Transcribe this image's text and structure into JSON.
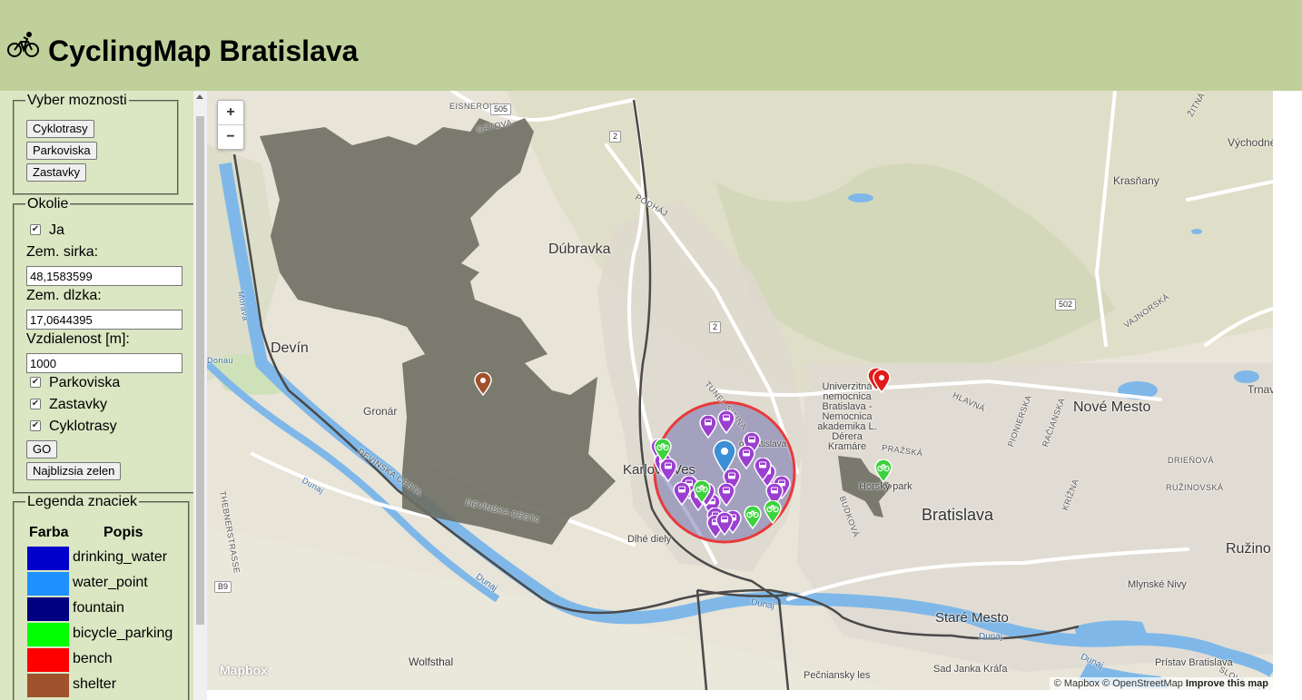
{
  "app": {
    "title": "CyclingMap Bratislava",
    "logo_icon": "cyclist-icon"
  },
  "options": {
    "legend": "Vyber moznosti",
    "buttons": [
      "Cyklotrasy",
      "Parkoviska",
      "Zastavky"
    ]
  },
  "surroundings": {
    "legend": "Okolie",
    "me_label": "Ja",
    "me_checked": true,
    "lat_label": "Zem. sirka:",
    "lat_value": "48,1583599",
    "lon_label": "Zem. dlzka:",
    "lon_value": "17,0644395",
    "distance_label": "Vzdialenost [m]:",
    "distance_value": "1000",
    "filters": [
      {
        "label": "Parkoviska",
        "checked": true
      },
      {
        "label": "Zastavky",
        "checked": true
      },
      {
        "label": "Cyklotrasy",
        "checked": true
      }
    ],
    "go_label": "GO",
    "nearest_green_label": "Najblizsia zelen"
  },
  "legend_panel": {
    "legend": "Legenda znaciek",
    "col_color": "Farba",
    "col_desc": "Popis",
    "items": [
      {
        "color": "#0000cd",
        "label": "drinking_water"
      },
      {
        "color": "#1e90ff",
        "label": "water_point"
      },
      {
        "color": "#000080",
        "label": "fountain"
      },
      {
        "color": "#00ff00",
        "label": "bicycle_parking"
      },
      {
        "color": "#ff0000",
        "label": "bench"
      },
      {
        "color": "#a0522d",
        "label": "shelter"
      }
    ]
  },
  "map": {
    "zoom_in": "+",
    "zoom_out": "−",
    "logo": "Mapbox",
    "attribution_prefix": "© Mapbox © OpenStreetMap",
    "attribution_link": "Improve this map",
    "places": {
      "eisnerova": "EISNEROVA",
      "gatova": "GÁTOVA",
      "road505": "505",
      "road2a": "2",
      "road2b": "2",
      "road502": "502",
      "road_b9": "B9",
      "podhaj": "PODHÁJ",
      "dubravka": "Dúbravka",
      "devin": "Devín",
      "gronar": "Gronár",
      "devinska_cesta": "DEVÍNSKA CESTA",
      "devinska_cesta2": "DEVÍNSKA CESTA",
      "karlova_ves": "Karlova Ves",
      "dlhe_diely": "Dlhé diely",
      "wolfsthal": "Wolfsthal",
      "pecniansky_les": "Pečniansky les",
      "sad_janka_krala": "Sad Janka Kráľa",
      "stare_mesto": "Staré Mesto",
      "bratislava": "Bratislava",
      "nove_mesto": "Nové Mesto",
      "ruzinov": "Ružino",
      "mlynske_nivy": "Mlynské Nivy",
      "vychodne": "Východné",
      "krasnany": "Krasňany",
      "trnav": "Trnav",
      "hospital": [
        "Univerzitná",
        "nemocnica",
        "Bratislava -",
        "Nemocnica",
        "akademika L.",
        "Dérera",
        "Kramáre"
      ],
      "horsky_park": "Horský park",
      "dunaj1": "Dunaj",
      "dunaj2": "Dunaj",
      "dunaj3": "Dunaj",
      "dunaj4": "Dunaj",
      "dunaj5": "Dunaj",
      "morava": "Morava",
      "tunel": "TUNEL SITINA",
      "prazska": "PRAŽSKÁ",
      "hlavna": "HLAVNÁ",
      "budkova": "BUDKOVÁ",
      "pionierska": "PIONIERSKA",
      "racianska": "RAČIANSKA",
      "vajnorska": "VAJNORSKÁ",
      "zitna": "ŽITNÁ",
      "drienova": "DRIEŇOVÁ",
      "ruzinovska": "RUŽINOVSKÁ",
      "slovnaft": "SLOVNAFT",
      "pristav": "Prístav Bratislava",
      "thebnerstrasse": "THEBNERSTRASSE",
      "krizna": "KRÍŽNA",
      "karlova_ves_bratislava": "o Bratislava",
      "donau": "Donau"
    }
  }
}
